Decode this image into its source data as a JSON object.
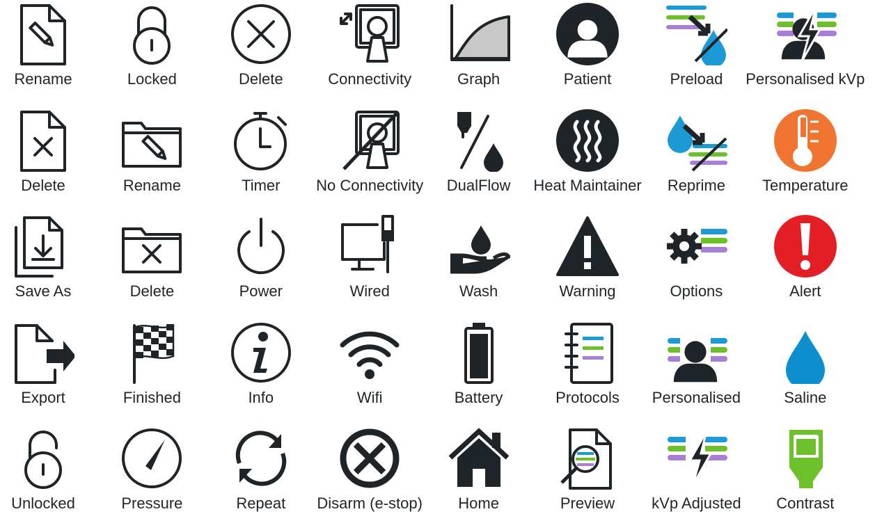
{
  "colors": {
    "dark": "#1e2428",
    "blue": "#1b9ad6",
    "green": "#6cc12a",
    "purple": "#a87fd6",
    "orange": "#f07530",
    "red": "#e31e24",
    "grey": "#c8c8c8"
  },
  "icons": [
    {
      "label": "Rename",
      "icon": "rename-file-icon"
    },
    {
      "label": "Locked",
      "icon": "lock-icon"
    },
    {
      "label": "Delete",
      "icon": "delete-circle-icon"
    },
    {
      "label": "Connectivity",
      "icon": "connectivity-icon"
    },
    {
      "label": "Graph",
      "icon": "graph-icon"
    },
    {
      "label": "Patient",
      "icon": "patient-icon"
    },
    {
      "label": "Preload",
      "icon": "preload-icon"
    },
    {
      "label": "Personalised kVp",
      "icon": "personalised-kvp-icon"
    },
    {
      "label": "Delete",
      "icon": "delete-file-icon"
    },
    {
      "label": "Rename",
      "icon": "rename-folder-icon"
    },
    {
      "label": "Timer",
      "icon": "timer-icon"
    },
    {
      "label": "No Connectivity",
      "icon": "no-connectivity-icon"
    },
    {
      "label": "DualFlow",
      "icon": "dualflow-icon"
    },
    {
      "label": "Heat Maintainer",
      "icon": "heat-maintainer-icon"
    },
    {
      "label": "Reprime",
      "icon": "reprime-icon"
    },
    {
      "label": "Temperature",
      "icon": "temperature-icon"
    },
    {
      "label": "Save As",
      "icon": "save-as-icon"
    },
    {
      "label": "Delete",
      "icon": "delete-folder-icon"
    },
    {
      "label": "Power",
      "icon": "power-icon"
    },
    {
      "label": "Wired",
      "icon": "wired-icon"
    },
    {
      "label": "Wash",
      "icon": "wash-icon"
    },
    {
      "label": "Warning",
      "icon": "warning-icon"
    },
    {
      "label": "Options",
      "icon": "options-icon"
    },
    {
      "label": "Alert",
      "icon": "alert-icon"
    },
    {
      "label": "Export",
      "icon": "export-icon"
    },
    {
      "label": "Finished",
      "icon": "checkered-flag-icon"
    },
    {
      "label": "Info",
      "icon": "info-icon"
    },
    {
      "label": "Wifi",
      "icon": "wifi-icon"
    },
    {
      "label": "Battery",
      "icon": "battery-icon"
    },
    {
      "label": "Protocols",
      "icon": "protocols-icon"
    },
    {
      "label": "Personalised",
      "icon": "personalised-icon"
    },
    {
      "label": "Saline",
      "icon": "saline-drop-icon"
    },
    {
      "label": "Unlocked",
      "icon": "unlock-icon"
    },
    {
      "label": "Pressure",
      "icon": "pressure-gauge-icon"
    },
    {
      "label": "Repeat",
      "icon": "repeat-icon"
    },
    {
      "label": "Disarm (e-stop)",
      "icon": "disarm-icon"
    },
    {
      "label": "Home",
      "icon": "home-icon"
    },
    {
      "label": "Preview",
      "icon": "preview-icon"
    },
    {
      "label": "kVp Adjusted",
      "icon": "kvp-adjusted-icon"
    },
    {
      "label": "Contrast",
      "icon": "contrast-icon"
    }
  ]
}
